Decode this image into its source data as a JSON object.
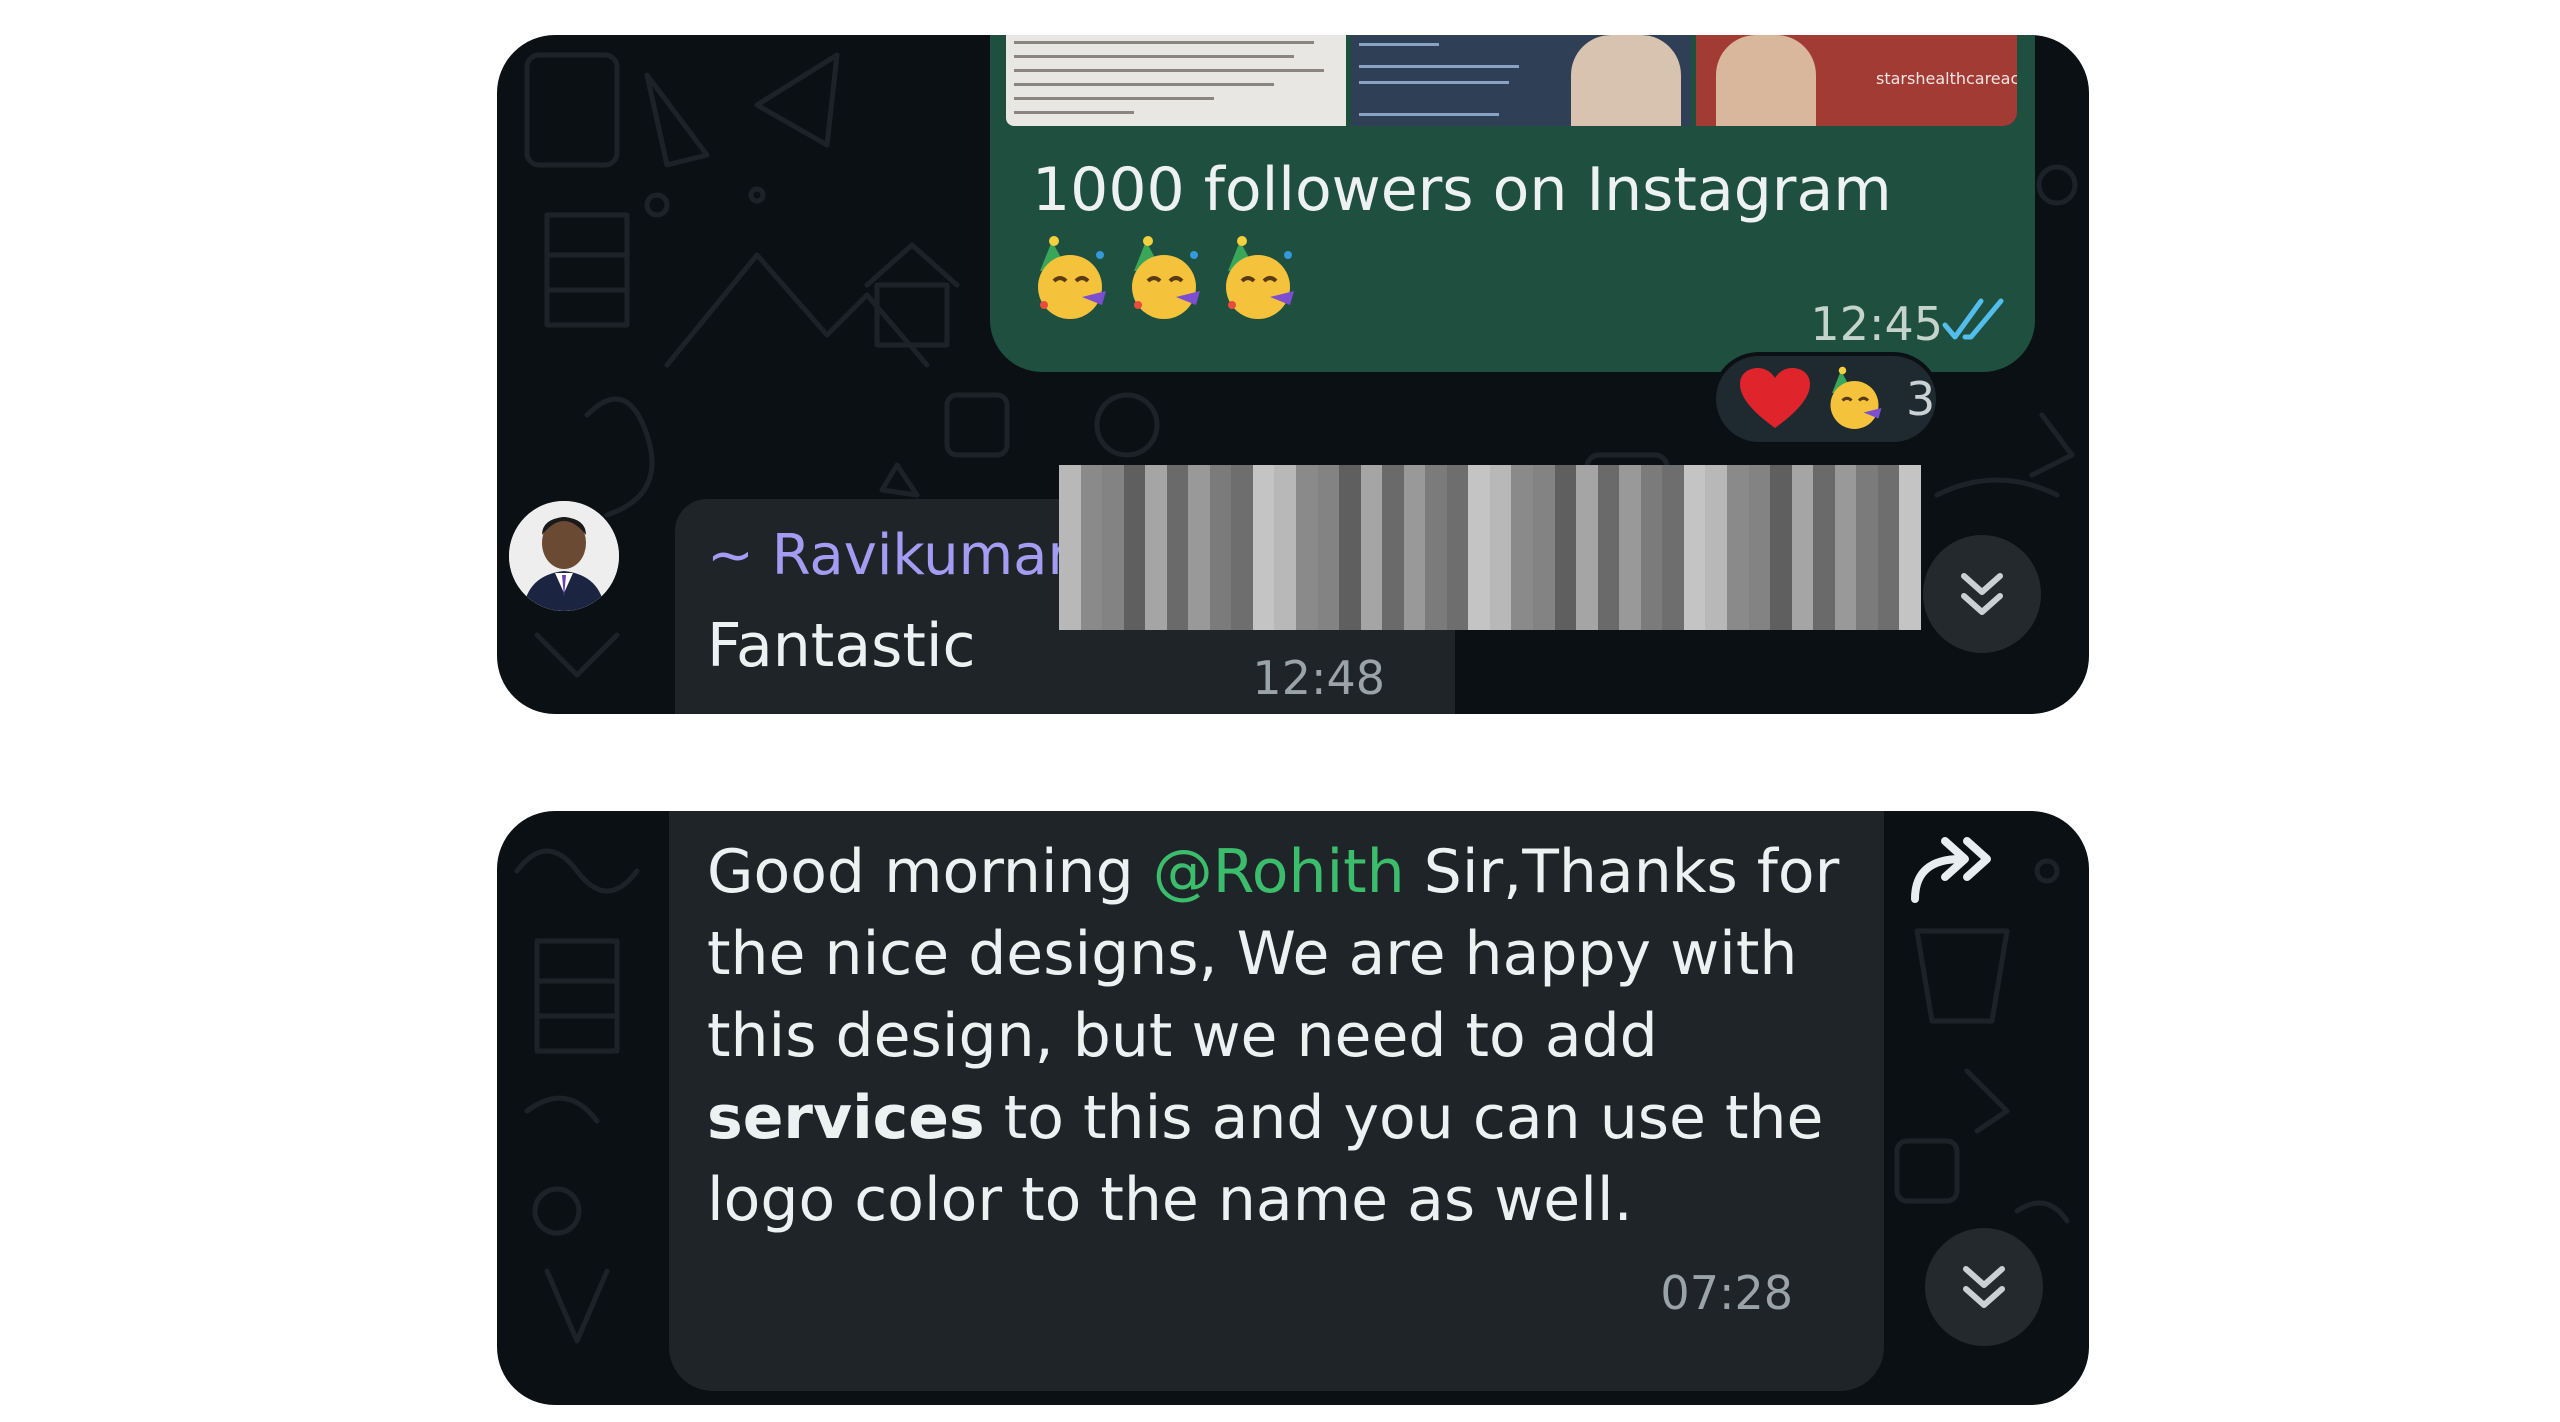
{
  "panel_top": {
    "outgoing_message": {
      "text": "1000 followers on Instagram",
      "emoji": [
        "party-face",
        "party-face",
        "party-face"
      ],
      "time": "12:45",
      "status": "read"
    },
    "media_preview": {
      "url_text": "starshealthcareacademy.com"
    },
    "reactions": {
      "emojis": [
        "heart",
        "party-face"
      ],
      "count": "3"
    },
    "incoming_message": {
      "sender": "~ Ravikumar",
      "text": "Fantastic",
      "time": "12:48"
    }
  },
  "panel_bottom": {
    "message": {
      "text_before": "Good morning ",
      "mention": "@Rohith",
      "text_middle": " Sir,Thanks for the nice designs, We are happy with this design, but we need to add ",
      "bold_word": "services",
      "text_after": " to this and you can use the logo color to the name as well.",
      "time": "07:28"
    }
  },
  "colors": {
    "chat_background": "#0b1014",
    "outgoing_bubble": "#1f4f3e",
    "incoming_bubble": "#1f2428",
    "sender_name": "#a29cf2",
    "mention": "#3bbd6c",
    "read_ticks": "#53bdeb"
  }
}
